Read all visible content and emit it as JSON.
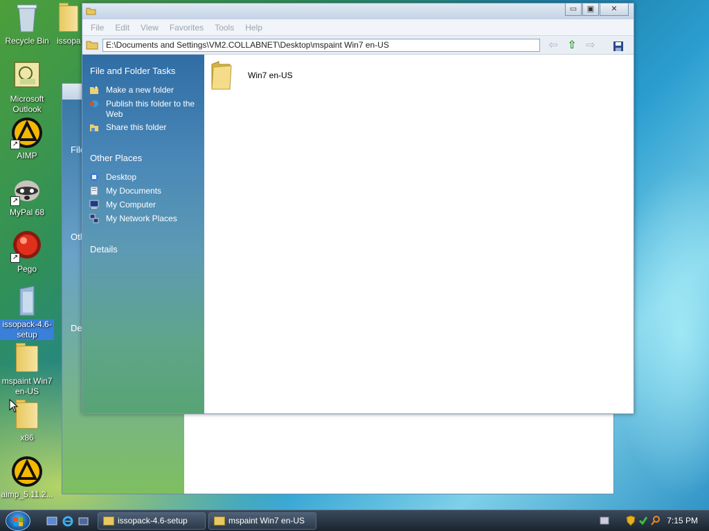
{
  "desktop": {
    "icons": [
      {
        "label": "Recycle Bin"
      },
      {
        "label": "Microsoft Outlook"
      },
      {
        "label": "AIMP"
      },
      {
        "label": "MyPal 68"
      },
      {
        "label": "Pego"
      },
      {
        "label": "issopack-4.6-setup"
      },
      {
        "label": "mspaint Win7 en-US"
      },
      {
        "label": "x86"
      },
      {
        "label": "aimp_5.11.2..."
      },
      {
        "label": "issopa"
      }
    ]
  },
  "window": {
    "menu": [
      "File",
      "Edit",
      "View",
      "Favorites",
      "Tools",
      "Help"
    ],
    "address": "E:\\Documents and Settings\\VM2.COLLABNET\\Desktop\\mspaint Win7 en-US",
    "min_glyph": "▭",
    "max_glyph": "▣",
    "close_glyph": "✕",
    "tasks_title": "File and Folder Tasks",
    "tasks": [
      "Make a new folder",
      "Publish this folder to the Web",
      "Share this folder"
    ],
    "places_title": "Other Places",
    "places": [
      "Desktop",
      "My Documents",
      "My Computer",
      "My Network Places"
    ],
    "details_title": "Details",
    "items": [
      {
        "name": "Win7 en-US"
      }
    ]
  },
  "back_window": {
    "side_snippets": [
      "File",
      "Oth",
      "De"
    ]
  },
  "taskbar": {
    "buttons": [
      "issopack-4.6-setup",
      "mspaint Win7 en-US"
    ],
    "clock": "7:15 PM"
  },
  "colors": {
    "taskpane_top": "#2f6da4",
    "taskpane_bottom": "#58a474",
    "selection": "#3a7fd8"
  }
}
